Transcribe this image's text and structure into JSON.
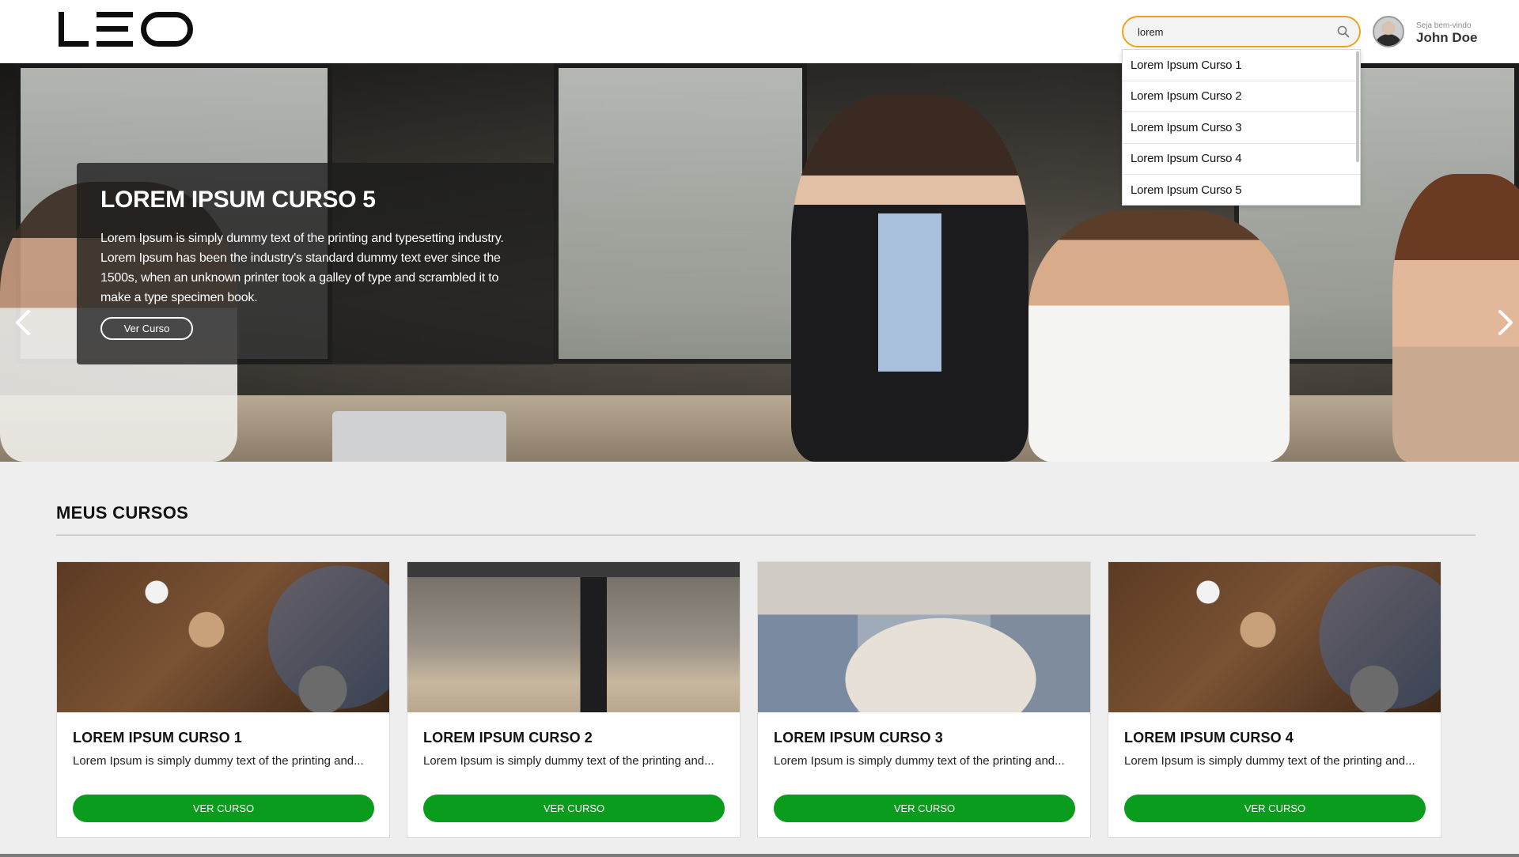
{
  "header": {
    "search": {
      "value": "lorem",
      "placeholder": ""
    },
    "user": {
      "welcome": "Seja bem-vindo",
      "name": "John Doe"
    }
  },
  "search_results": [
    "Lorem Ipsum Curso 1",
    "Lorem Ipsum Curso 2",
    "Lorem Ipsum Curso 3",
    "Lorem Ipsum Curso 4",
    "Lorem Ipsum Curso 5"
  ],
  "hero": {
    "title": "LOREM IPSUM CURSO 5",
    "description": "Lorem Ipsum is simply dummy text of the printing and typesetting industry. Lorem Ipsum has been the industry's standard dummy text ever since the 1500s, when an unknown printer took a galley of type and scrambled it to make a type specimen book.",
    "button_label": "Ver Curso"
  },
  "section": {
    "title": "MEUS CURSOS"
  },
  "courses": [
    {
      "title": "LOREM IPSUM CURSO 1",
      "description": "Lorem Ipsum is simply dummy text of the printing and...",
      "button_label": "VER CURSO"
    },
    {
      "title": "LOREM IPSUM CURSO 2",
      "description": "Lorem Ipsum is simply dummy text of the printing and...",
      "button_label": "VER CURSO"
    },
    {
      "title": "LOREM IPSUM CURSO 3",
      "description": "Lorem Ipsum is simply dummy text of the printing and...",
      "button_label": "VER CURSO"
    },
    {
      "title": "LOREM IPSUM CURSO 4",
      "description": "Lorem Ipsum is simply dummy text of the printing and...",
      "button_label": "VER CURSO"
    }
  ],
  "colors": {
    "accent": "#0a9c1c",
    "search_border": "#f1a21c"
  },
  "icons": {
    "search": "search-icon",
    "prev": "chevron-left-icon",
    "next": "chevron-right-icon"
  }
}
